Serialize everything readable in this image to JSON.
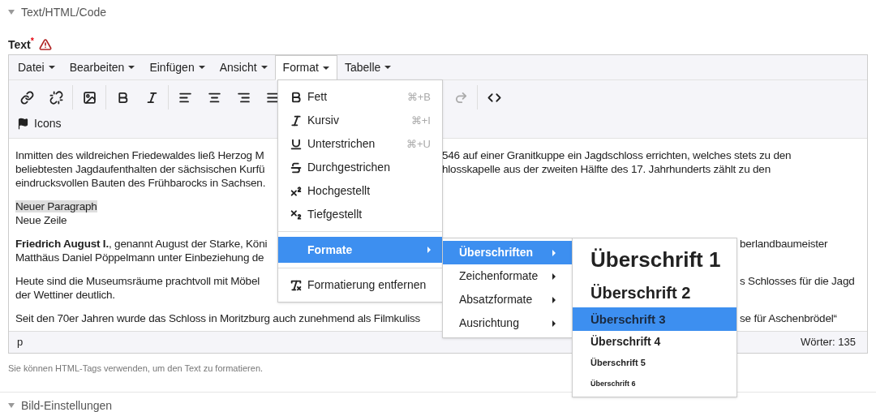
{
  "sections": [
    {
      "title": "Text/HTML/Code",
      "expanded": true
    },
    {
      "title": "Bild-Einstellungen",
      "expanded": true
    }
  ],
  "field": {
    "label": "Text",
    "required_mark": "*",
    "help": "Sie können HTML-Tags verwenden, um den Text zu formatieren."
  },
  "menubar": [
    {
      "label": "Datei",
      "selected": false
    },
    {
      "label": "Bearbeiten",
      "selected": false
    },
    {
      "label": "Einfügen",
      "selected": false
    },
    {
      "label": "Ansicht",
      "selected": false
    },
    {
      "label": "Format",
      "selected": true
    },
    {
      "label": "Tabelle",
      "selected": false
    }
  ],
  "toolbar": [
    {
      "disabled": false
    },
    {
      "disabled": false
    },
    {
      "disabled": false
    },
    {
      "disabled": false
    },
    {
      "disabled": false
    },
    {
      "disabled": false
    },
    {
      "disabled": false
    },
    {
      "disabled": false
    },
    {
      "disabled": false
    },
    {
      "disabled": true
    },
    {
      "disabled": false
    }
  ],
  "toolbar_button": {
    "label": "Icons"
  },
  "content": [
    {
      "lines": [
        {
          "left": "Inmitten des wildreichen Friedewaldes ließ Herzog M",
          "right": "546 auf einer Granitkuppe ein Jagdschloss errichten, welches stets zu den"
        },
        {
          "left": "beliebtesten Jagdaufenthalten der sächsischen Kurfü",
          "right": "hlosskapelle aus der zweiten Hälfte des 17. Jahrhunderts zählt zu den"
        },
        {
          "left": "eindrucksvollen Bauten des Frühbarocks in Sachsen."
        }
      ]
    },
    {
      "lines": [
        {
          "left": "Neuer Paragraph",
          "highlighted": true
        },
        {
          "left": "Neue Zeile",
          "highlighted": false
        }
      ]
    },
    {
      "lines": [
        {
          "left": "**Friedrich August I.**, genannt August der Starke, Köni",
          "right": "berlandbaumeister"
        },
        {
          "left": "Matthäus Daniel Pöppelmann unter Einbeziehung de"
        }
      ]
    },
    {
      "lines": [
        {
          "left": "Heute sind die Museumsräume prachtvoll mit Möbel",
          "right": "s Schlosses für die Jagd"
        },
        {
          "left": "der Wettiner deutlich."
        }
      ]
    },
    {
      "lines": [
        {
          "left": "Seit den 70er Jahren wurde das Schloss in Moritzburg auch zunehmend als Filmkuliss",
          "right": "se für Aschenbrödel“"
        }
      ]
    }
  ],
  "statusbar": {
    "path": "p",
    "words": "Wörter: 135"
  },
  "format_menu": [
    {
      "kind": "item",
      "label": "Fett",
      "shortcut": "⌘+B"
    },
    {
      "kind": "item",
      "label": "Kursiv",
      "shortcut": "⌘+I"
    },
    {
      "kind": "item",
      "label": "Unterstrichen",
      "shortcut": "⌘+U"
    },
    {
      "kind": "item",
      "label": "Durchgestrichen"
    },
    {
      "kind": "item",
      "label": "Hochgestellt"
    },
    {
      "kind": "item",
      "label": "Tiefgestellt"
    },
    {
      "kind": "separator"
    },
    {
      "kind": "submenu",
      "label": "Formate",
      "selected": true
    },
    {
      "kind": "separator"
    },
    {
      "kind": "item",
      "label": "Formatierung entfernen"
    }
  ],
  "formats_menu": [
    {
      "label": "Überschriften",
      "selected": true
    },
    {
      "label": "Zeichenformate",
      "selected": false
    },
    {
      "label": "Absatzformate",
      "selected": false
    },
    {
      "label": "Ausrichtung",
      "selected": false
    }
  ],
  "headings_menu": [
    {
      "label": "Überschrift 1",
      "selected": false
    },
    {
      "label": "Überschrift 2",
      "selected": false
    },
    {
      "label": "Überschrift 3",
      "selected": true
    },
    {
      "label": "Überschrift 4",
      "selected": false
    },
    {
      "label": "Überschrift 5",
      "selected": false
    },
    {
      "label": "Überschrift 6",
      "selected": false
    }
  ]
}
